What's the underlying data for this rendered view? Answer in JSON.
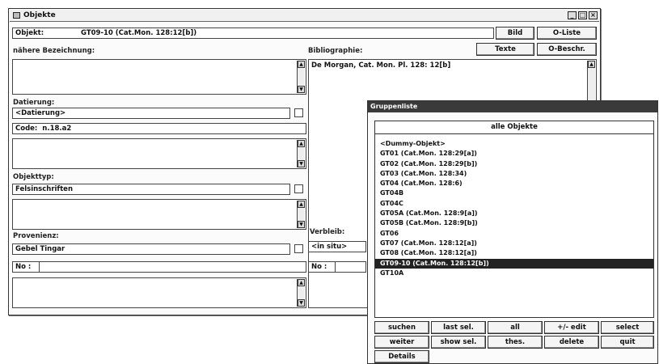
{
  "main_window": {
    "title": "Objekte",
    "controls": {
      "minimize": "_",
      "maximize": "□",
      "close": "×"
    },
    "objekt_label": "Objekt:",
    "objekt_value": "GT09-10 (Cat.Mon. 128:12[b])",
    "buttons": {
      "bild": "Bild",
      "o_liste": "O-Liste",
      "texte": "Texte",
      "o_beschr": "O-Beschr."
    },
    "naehere_bezeichnung_label": "nähere Bezeichnung:",
    "naehere_bezeichnung_value": "",
    "bibliographie_label": "Bibliographie:",
    "bibliographie_value": "De Morgan, Cat. Mon. Pl. 128: 12[b]",
    "datierung_label": "Datierung:",
    "datierung_value": "<Datierung>",
    "code_label": "Code:",
    "code_value": "n.18.a2",
    "objekttyp_label": "Objekttyp:",
    "objekttyp_value": "Felsinschriften",
    "provenienz_label": "Provenienz:",
    "provenienz_value": "Gebel Tingar",
    "verbleib_label": "Verbleib:",
    "verbleib_value": "<in situ>",
    "no_label": "No :",
    "no_value": "",
    "no_label_right": "No :",
    "no_value_right": ""
  },
  "group_window": {
    "title": "Gruppenliste",
    "list_header": "alle Objekte",
    "items": [
      "<Dummy-Objekt>",
      "GT01 (Cat.Mon. 128:29[a])",
      "GT02 (Cat.Mon. 128:29[b])",
      "GT03 (Cat.Mon. 128:34)",
      "GT04 (Cat.Mon. 128:6)",
      "GT04B",
      "GT04C",
      "GT05A (Cat.Mon. 128:9[a])",
      "GT05B (Cat.Mon. 128:9[b])",
      "GT06",
      "GT07 (Cat.Mon. 128:12[a])",
      "GT08 (Cat.Mon. 128:12[a])",
      "GT09-10 (Cat.Mon. 128:12[b])",
      "GT10A"
    ],
    "selected_index": 12,
    "buttons": {
      "suchen": "suchen",
      "last_sel": "last sel.",
      "all": "all",
      "plus_minus_edit": "+/- edit",
      "select": "select",
      "weiter": "weiter",
      "show_sel": "show sel.",
      "thes": "thes.",
      "delete": "delete",
      "quit": "quit",
      "details": "Details"
    }
  }
}
